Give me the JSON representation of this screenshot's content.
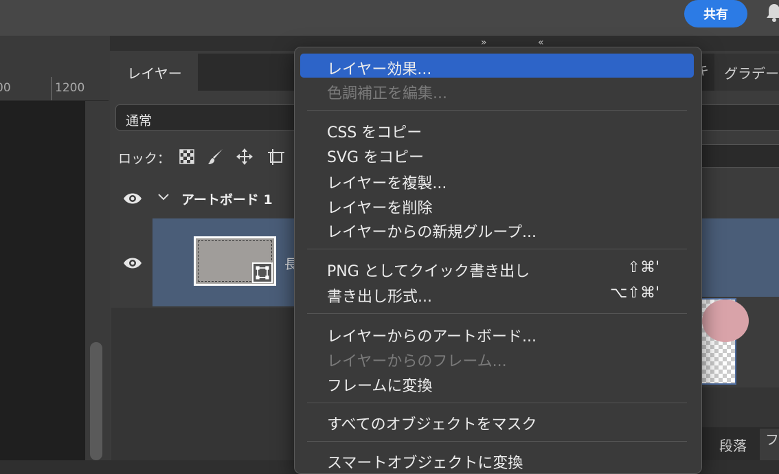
{
  "topbar": {
    "share_label": "共有"
  },
  "ruler": {
    "label_1": "00",
    "label_2": "1200"
  },
  "panel": {
    "tab_layers": "レイヤー",
    "tab_partial": "キ",
    "tab_gradient": "グラデー",
    "blend_mode": "通常",
    "lock_label": "ロック：",
    "artboard_name": "アートボード 1",
    "rect_layer_partial": "長",
    "tab_paragraph": "段落",
    "tab_right_edge": "フ"
  },
  "menu": {
    "items": [
      {
        "label": "レイヤー効果...",
        "enabled": true,
        "highlighted": true
      },
      {
        "label": "色調補正を編集...",
        "enabled": false
      },
      {
        "label": "CSS をコピー",
        "enabled": true
      },
      {
        "label": "SVG をコピー",
        "enabled": true
      },
      {
        "label": "レイヤーを複製...",
        "enabled": true
      },
      {
        "label": "レイヤーを削除",
        "enabled": true
      },
      {
        "label": "レイヤーからの新規グループ...",
        "enabled": true
      },
      {
        "label": "PNG としてクイック書き出し",
        "enabled": true,
        "shortcut": "⇧⌘'"
      },
      {
        "label": "書き出し形式...",
        "enabled": true,
        "shortcut": "⌥⇧⌘'"
      },
      {
        "label": "レイヤーからのアートボード...",
        "enabled": true
      },
      {
        "label": "レイヤーからのフレーム...",
        "enabled": false
      },
      {
        "label": "フレームに変換",
        "enabled": true
      },
      {
        "label": "すべてのオブジェクトをマスク",
        "enabled": true
      },
      {
        "label": "スマートオブジェクトに変換",
        "enabled": true
      }
    ]
  },
  "colors": {
    "accent": "#2c7be5",
    "menu_highlight": "#2d64c8",
    "selected_row": "#4a5d78"
  }
}
